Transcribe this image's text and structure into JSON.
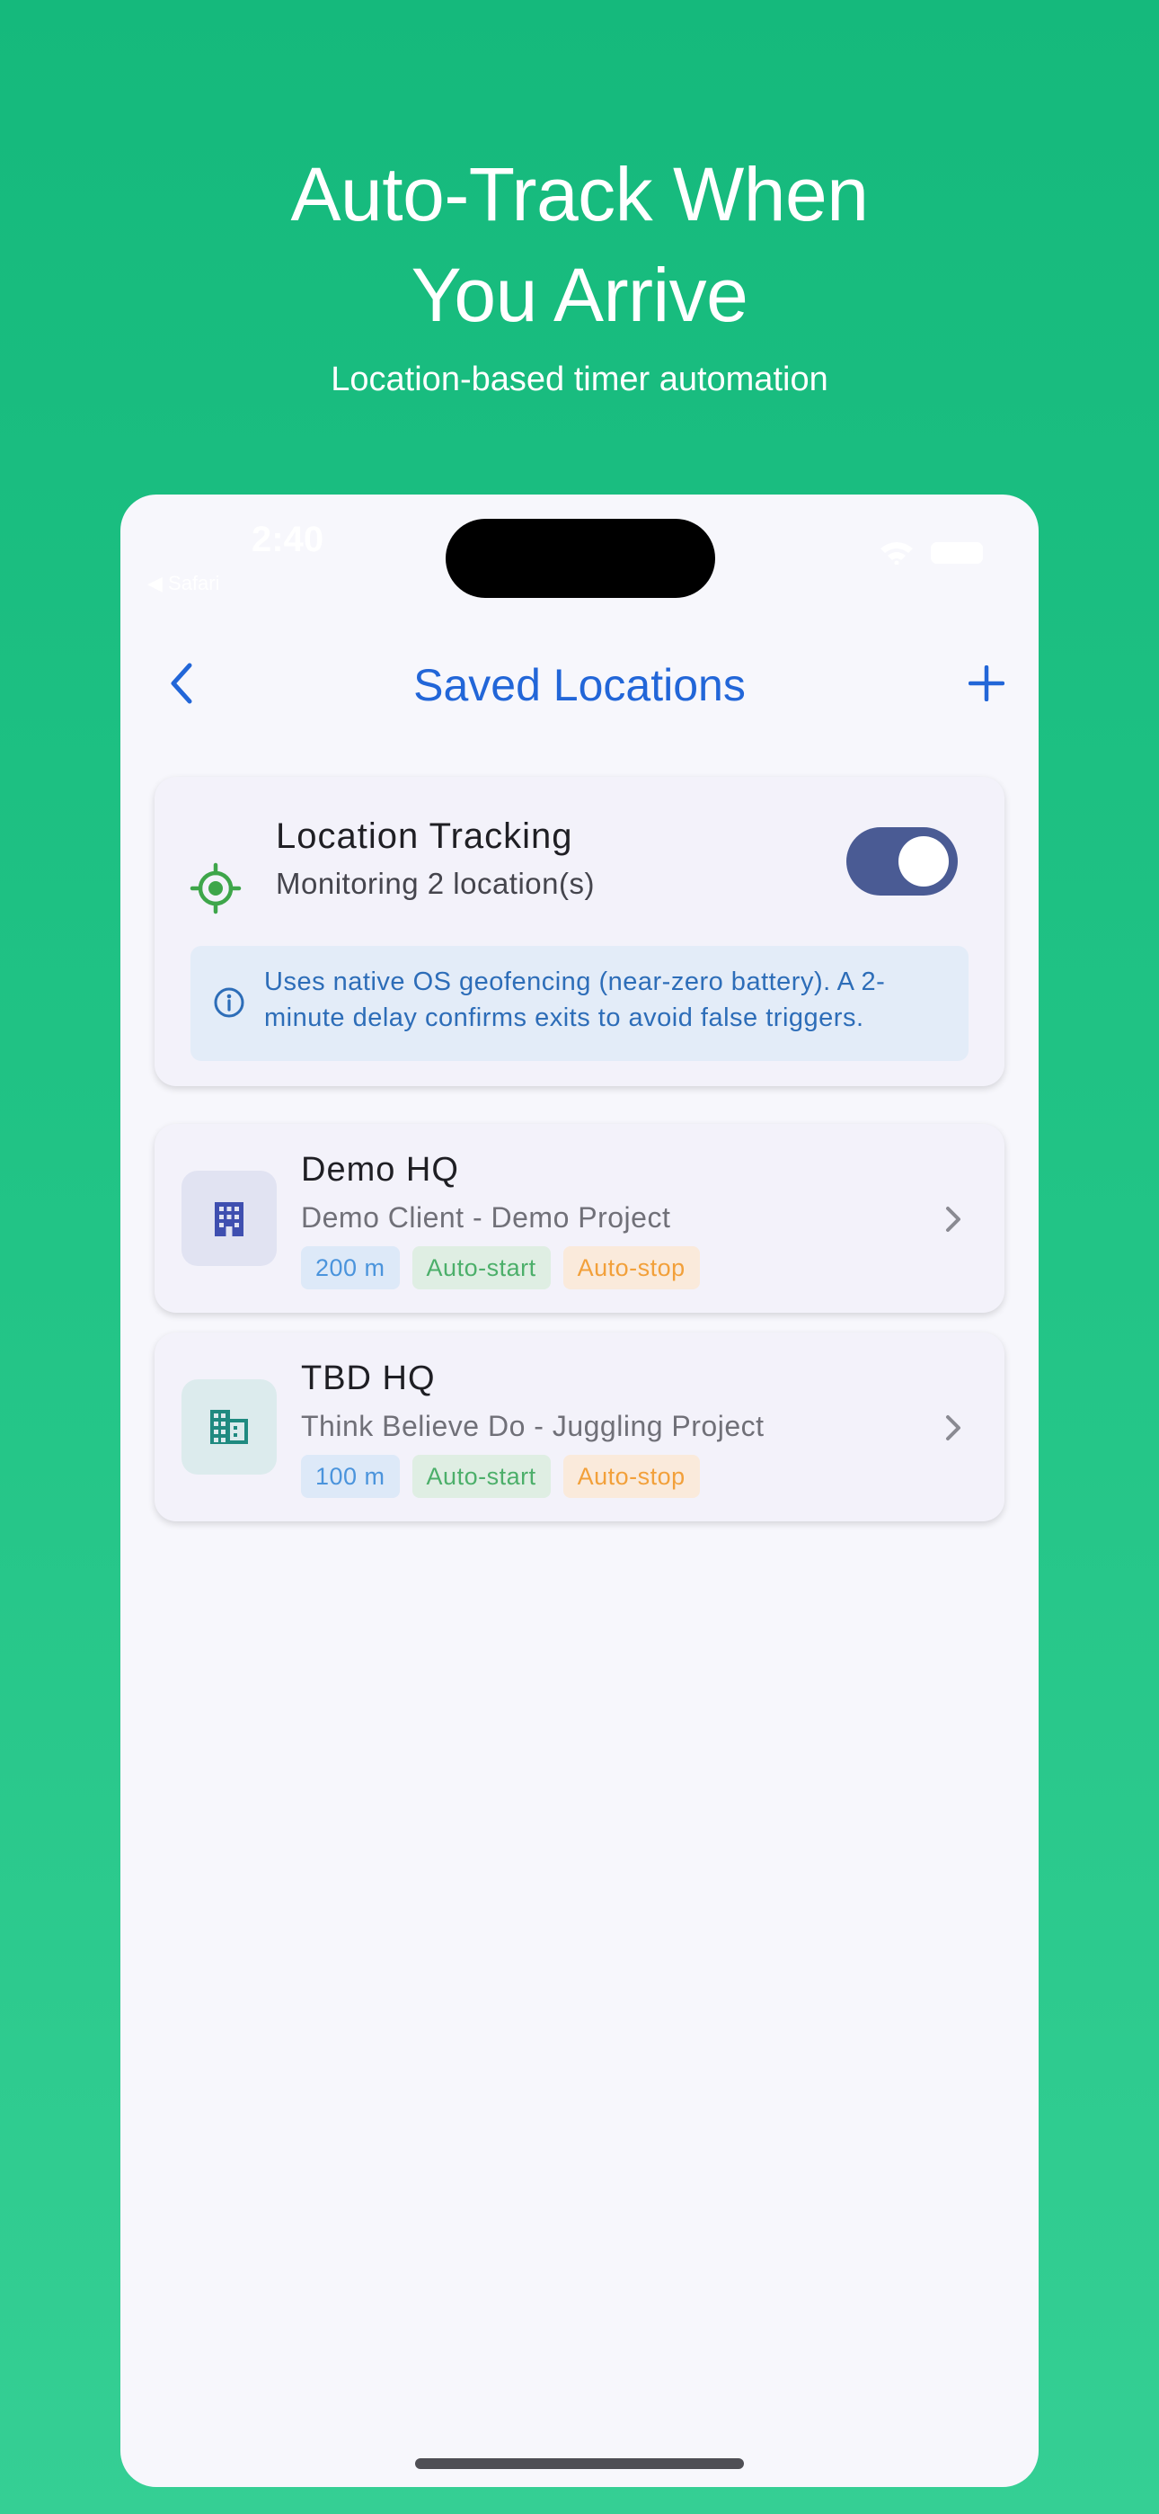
{
  "promo": {
    "headline_line1": "Auto-Track When",
    "headline_line2": "You Arrive",
    "subheadline": "Location-based timer automation"
  },
  "status_bar": {
    "time": "2:40",
    "back_app": "◀ Safari"
  },
  "nav": {
    "title": "Saved Locations",
    "back_icon": "chevron-left-icon",
    "add_icon": "plus-icon"
  },
  "tracking": {
    "title": "Location Tracking",
    "subtitle": "Monitoring 2 location(s)",
    "enabled": true,
    "info": "Uses native OS geofencing (near-zero battery). A 2-minute delay confirms exits to avoid false triggers."
  },
  "locations": [
    {
      "name": "Demo HQ",
      "description": "Demo Client - Demo Project",
      "radius": "200 m",
      "auto_start": "Auto-start",
      "auto_stop": "Auto-stop",
      "icon": "business-icon",
      "icon_color": "#3f4fb0"
    },
    {
      "name": "TBD HQ",
      "description": "Think Believe Do - Juggling Project",
      "radius": "100 m",
      "auto_start": "Auto-start",
      "auto_stop": "Auto-stop",
      "icon": "domain-icon",
      "icon_color": "#1f8a80"
    }
  ],
  "colors": {
    "accent": "#2266d8",
    "background_green": "#1cbf82",
    "toggle_on": "#4a5b94",
    "tracking_icon": "#3ea64a"
  }
}
